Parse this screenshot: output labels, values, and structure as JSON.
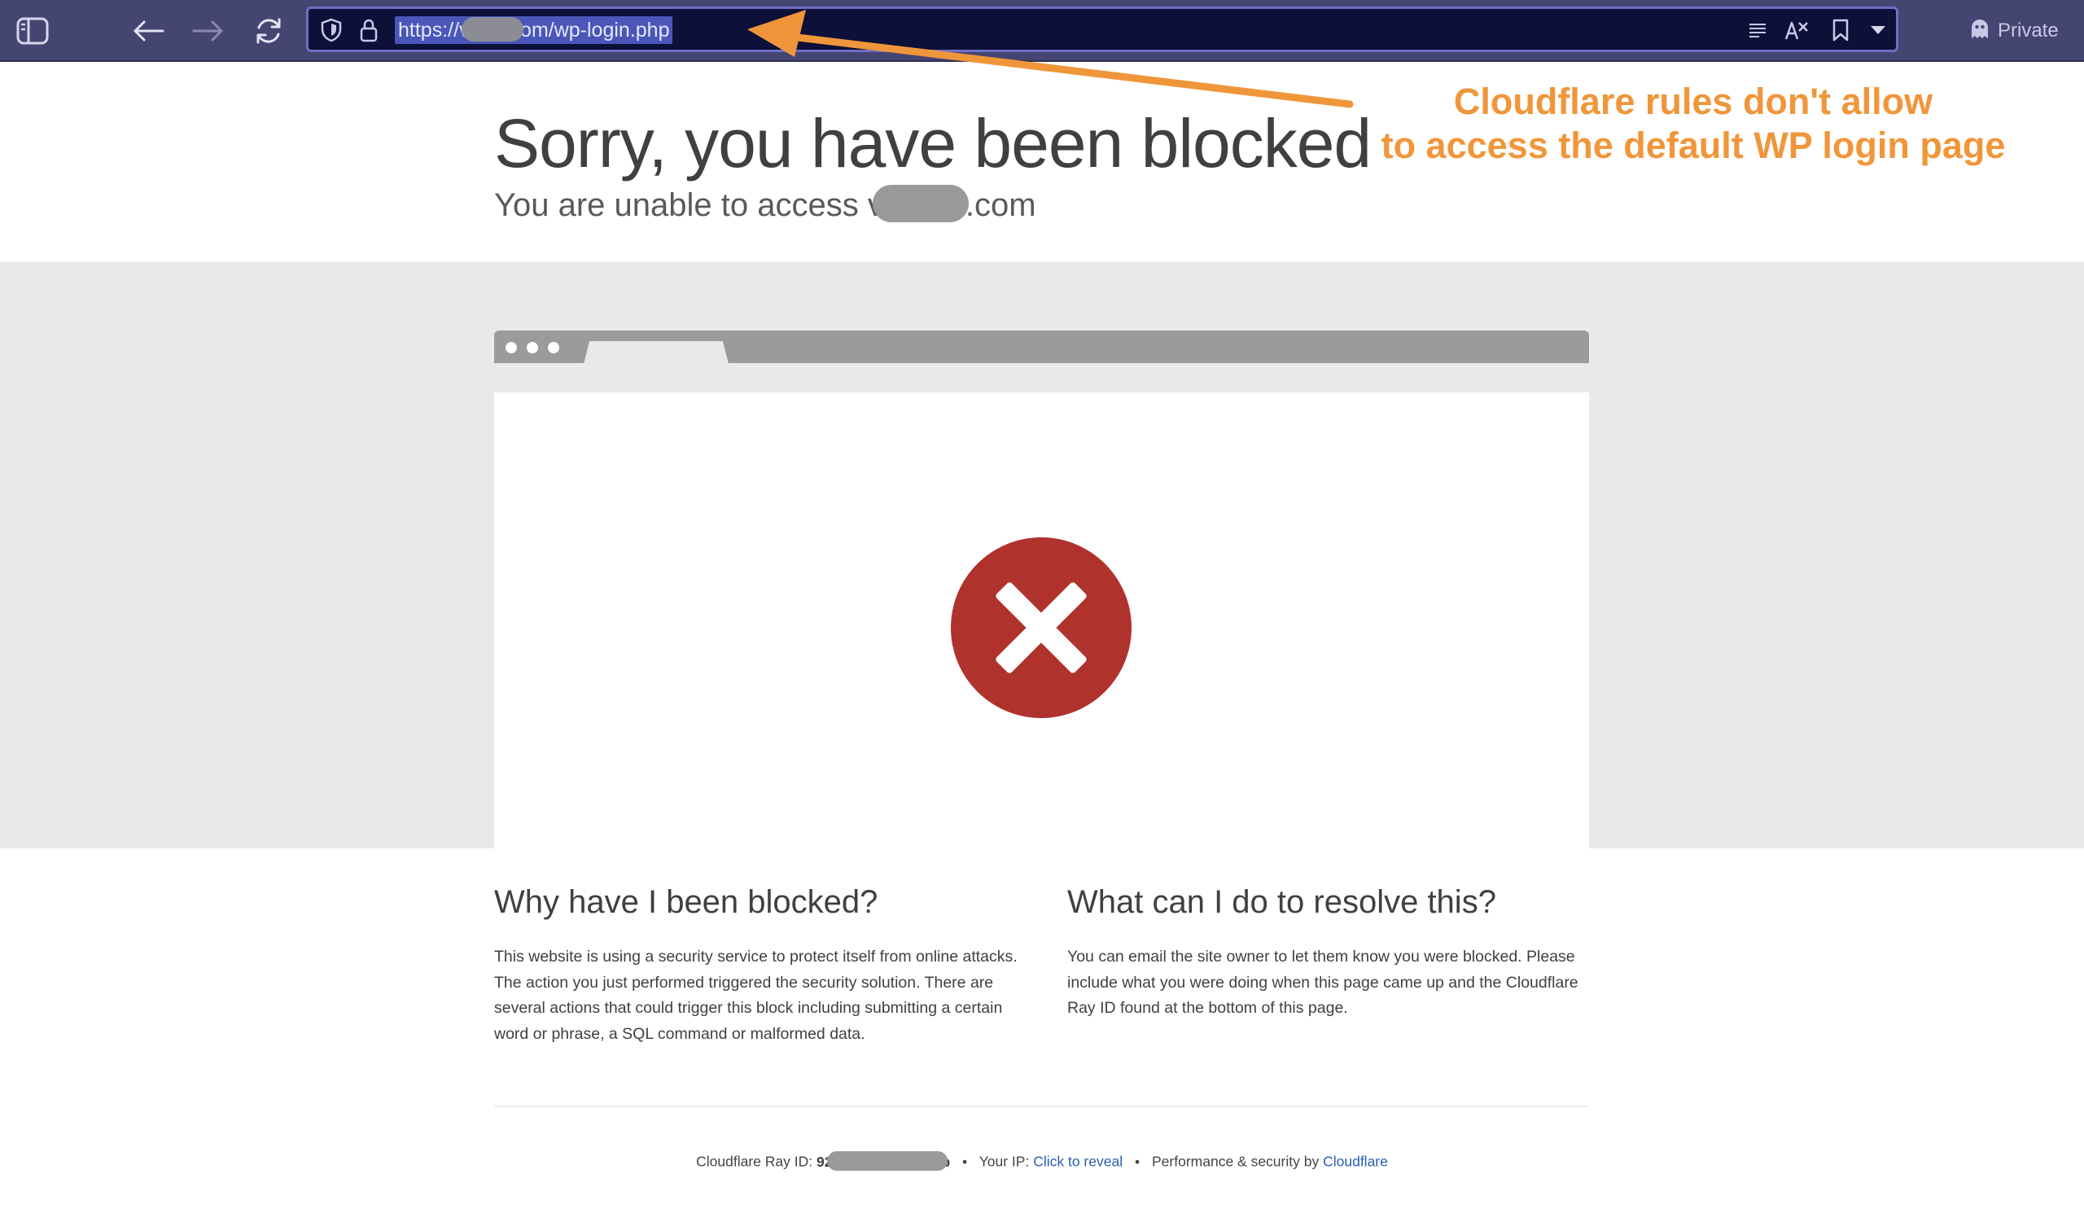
{
  "browser": {
    "url_prefix": "https://v",
    "url_suffix": "com/wp-login.php",
    "private_label": "Private"
  },
  "page": {
    "title": "Sorry, you have been blocked",
    "subtitle_prefix": "You are unable to access v",
    "subtitle_suffix": ".com",
    "why_heading": "Why have I been blocked?",
    "why_text": "This website is using a security service to protect itself from online attacks. The action you just performed triggered the security solution. There are several actions that could trigger this block including submitting a certain word or phrase, a SQL command or malformed data.",
    "resolve_heading": "What can I do to resolve this?",
    "resolve_text": "You can email the site owner to let them know you were blocked. Please include what you were doing when this page came up and the Cloudflare Ray ID found at the bottom of this page."
  },
  "footer": {
    "ray_label": "Cloudflare Ray ID:",
    "ray_prefix": "92",
    "ray_suffix": "b",
    "bullet": "•",
    "ip_label": "Your IP:",
    "ip_link": "Click to reveal",
    "perf_label": "Performance & security by",
    "perf_link": "Cloudflare"
  },
  "annotation": {
    "line1": "Cloudflare rules don't allow",
    "line2": "to access the default WP login page"
  },
  "colors": {
    "toolbar": "#454572",
    "urlbar": "#0d1038",
    "url_highlight": "#4a57b8",
    "error_red": "#b0322d",
    "annotation": "#f0963a",
    "link": "#2c5db3"
  },
  "icons": [
    "sidebar-icon",
    "back-arrow-icon",
    "forward-arrow-icon",
    "reload-icon",
    "shield-icon",
    "lock-icon",
    "reader-icon",
    "translate-icon",
    "bookmark-icon",
    "chevron-down-icon",
    "ghost-icon",
    "error-x-icon"
  ]
}
